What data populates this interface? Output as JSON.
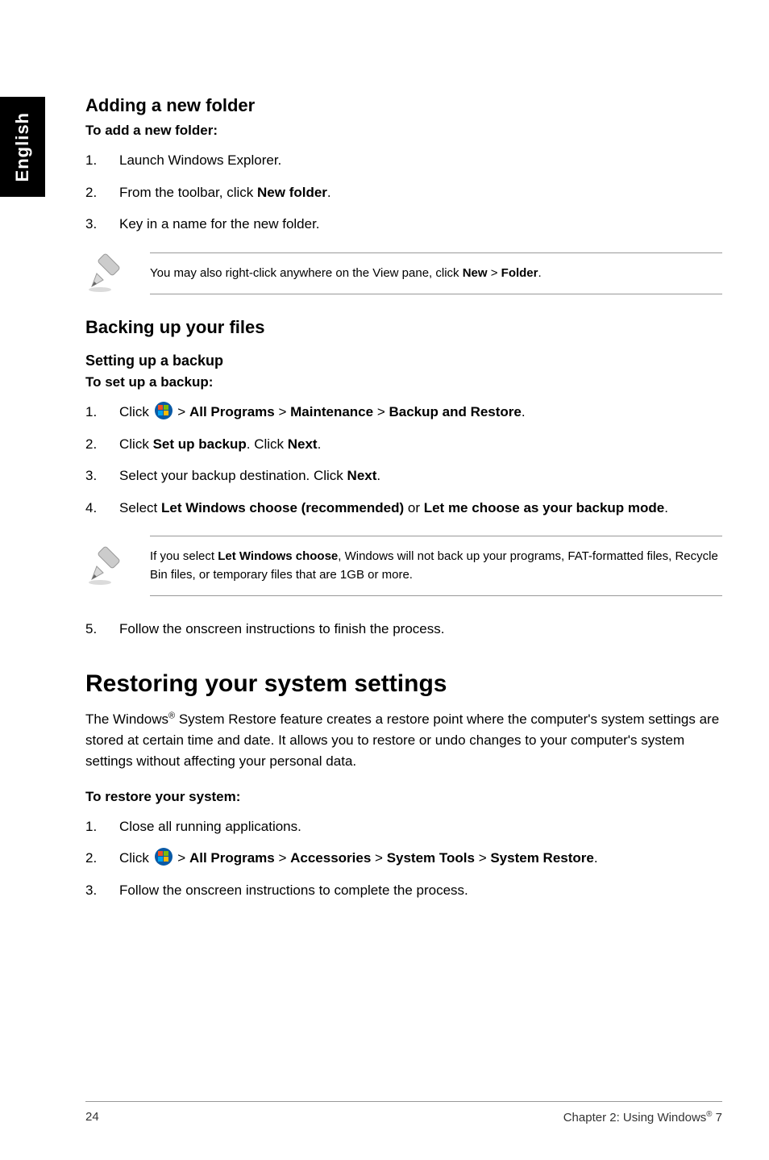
{
  "side_tab": "English",
  "sections": {
    "adding": {
      "title": "Adding a new folder",
      "lead": "To add a new folder:",
      "steps": {
        "s1": "Launch Windows Explorer.",
        "s2_a": "From the toolbar, click ",
        "s2_b": "New folder",
        "s2_c": ".",
        "s3": "Key in a name for the new folder."
      },
      "note_a": "You may also right-click anywhere on the View pane, click ",
      "note_b": "New",
      "note_gt": " > ",
      "note_c": "Folder",
      "note_d": "."
    },
    "backing": {
      "title": "Backing up your files",
      "subtitle": "Setting up a backup",
      "lead": "To set up a backup:",
      "steps": {
        "s1_a": "Click ",
        "s1_b": " > ",
        "s1_c": "All Programs",
        "s1_d": " > ",
        "s1_e": "Maintenance",
        "s1_f": " > ",
        "s1_g": "Backup and Restore",
        "s1_h": ".",
        "s2_a": "Click ",
        "s2_b": "Set up backup",
        "s2_c": ". Click ",
        "s2_d": "Next",
        "s2_e": ".",
        "s3_a": "Select your backup destination. Click ",
        "s3_b": "Next",
        "s3_c": ".",
        "s4_a": "Select ",
        "s4_b": "Let Windows choose (recommended)",
        "s4_c": " or ",
        "s4_d": "Let me choose as your backup mode",
        "s4_e": "."
      },
      "note_a": "If you select ",
      "note_b": "Let Windows choose",
      "note_c": ", Windows will not back up your programs, FAT-formatted files, Recycle Bin files, or temporary files that are 1GB or more.",
      "step5": "Follow the onscreen instructions to finish the process."
    },
    "restoring": {
      "title": "Restoring your system settings",
      "para_a": "The Windows",
      "para_sup": "®",
      "para_b": " System Restore feature creates a restore point where the computer's system settings are stored at certain time and date. It allows you to restore or undo changes to your computer's system settings without affecting your personal data.",
      "lead": "To restore your system:",
      "steps": {
        "s1": "Close all running applications.",
        "s2_a": "Click ",
        "s2_b": " > ",
        "s2_c": "All Programs",
        "s2_d": " > ",
        "s2_e": "Accessories",
        "s2_f": " > ",
        "s2_g": "System Tools",
        "s2_h": " > ",
        "s2_i": "System Restore",
        "s2_j": ".",
        "s3": "Follow the onscreen instructions to complete the process."
      }
    }
  },
  "footer": {
    "page": "24",
    "chapter_a": "Chapter 2: Using Windows",
    "chapter_sup": "®",
    "chapter_b": " 7"
  }
}
